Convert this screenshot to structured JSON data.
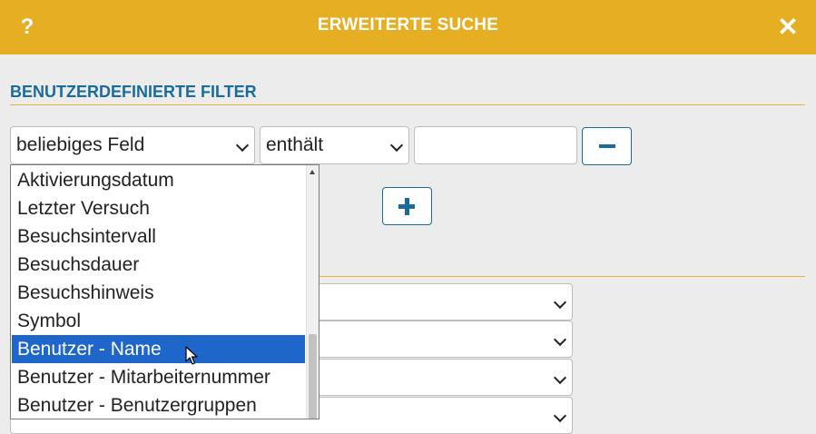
{
  "dialog": {
    "title": "ERWEITERTE SUCHE",
    "help_icon": "question-mark-icon",
    "help_label": "?",
    "close_icon": "close-icon",
    "close_label": "✕"
  },
  "filters": {
    "section_title": "BENUTZERDEFINIERTE FILTER",
    "field_select_value": "beliebiges Feld",
    "operator_select_value": "enthält",
    "value_input": "",
    "remove_icon": "minus-icon",
    "add_icon": "plus-icon"
  },
  "dropdown": {
    "items": [
      "Aktivierungsdatum",
      "Letzter Versuch",
      "Besuchsintervall",
      "Besuchsdauer",
      "Besuchshinweis",
      "Symbol",
      "Benutzer - Name",
      "Benutzer - Mitarbeiternummer",
      "Benutzer - Benutzergruppen"
    ],
    "selected_index": 6
  },
  "lower_selects": [
    "",
    "",
    "",
    ""
  ],
  "colors": {
    "header": "#e6ae22",
    "accent": "#1a6c9c",
    "selection": "#1e66c9"
  }
}
